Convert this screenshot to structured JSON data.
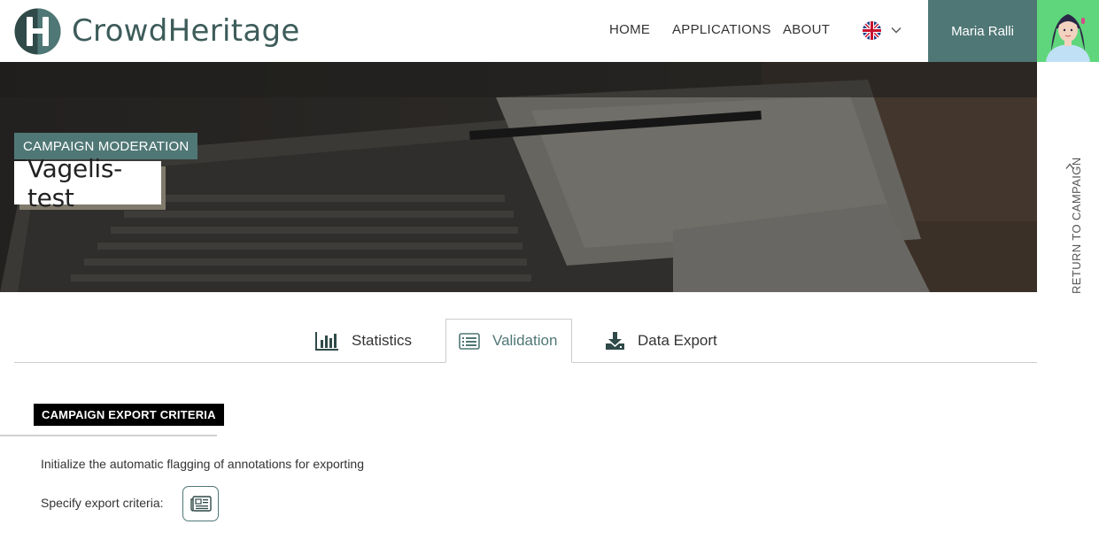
{
  "header": {
    "logo_text": "CrowdHeritage",
    "nav": [
      {
        "label": "HOME"
      },
      {
        "label": "APPLICATIONS"
      },
      {
        "label": "ABOUT"
      }
    ],
    "language_icon": "uk-flag-icon",
    "user_name": "Maria Ralli",
    "accent_color": "#4f7775"
  },
  "hero": {
    "tag": "CAMPAIGN MODERATION",
    "title": "Vagelis-test"
  },
  "return_link": {
    "label": "RETURN TO CAMPAIGN"
  },
  "tabs": [
    {
      "label": "Statistics",
      "icon": "bar-chart-icon",
      "active": false
    },
    {
      "label": "Validation",
      "icon": "list-icon",
      "active": true
    },
    {
      "label": "Data Export",
      "icon": "download-icon",
      "active": false
    }
  ],
  "export_section": {
    "heading": "CAMPAIGN EXPORT CRITERIA",
    "description": "Initialize the automatic flagging of annotations for exporting",
    "criteria_label": "Specify export criteria:",
    "criteria_button_icon": "newspaper-icon"
  }
}
